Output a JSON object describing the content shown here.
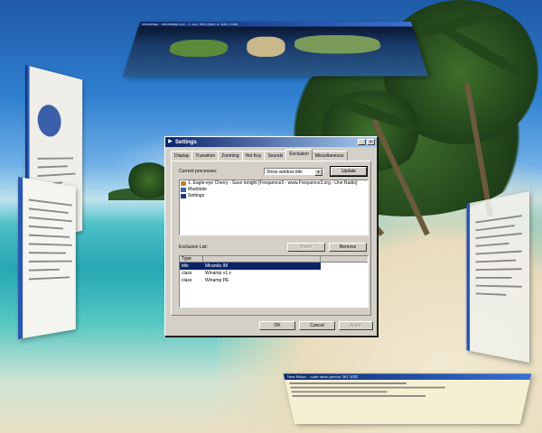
{
  "floating": {
    "top_title": "WorldMap - WorldMap.exe - 1 Gun Vien (Size 4, 100 x 100)",
    "bottom_title": "New Notes - carte wine presse 2k1 1002"
  },
  "dialog": {
    "title": "Settings",
    "tabs": [
      "Display",
      "Transition",
      "Zooming",
      "Hot Key",
      "Sounds",
      "Exclusion",
      "Miscellaneous"
    ],
    "active_tab": "Exclusion",
    "current_processes_label": "Current processes:",
    "filter_value": "Show window title",
    "update_label": "Update",
    "processes": [
      {
        "icon": "eagle-icon",
        "text": "1. Eagle-eye Cherry - Save tonight [Frequence3 - www.Frequence3.org - Une Radio]"
      },
      {
        "icon": "app-icon",
        "text": "Madotate"
      },
      {
        "icon": "settings-app-icon",
        "text": "Settings"
      }
    ],
    "exclusion_label": "Exclusion List:",
    "insert_label": "Insert",
    "remove_label": "Remove",
    "columns": [
      "Type",
      ""
    ],
    "exclusions": [
      {
        "type": "title",
        "name": "Miranda IM",
        "selected": true
      },
      {
        "type": "class",
        "name": "Winamp v1.x",
        "selected": false
      },
      {
        "type": "class",
        "name": "Winamp PE",
        "selected": false
      }
    ],
    "ok_label": "OK",
    "cancel_label": "Cancel",
    "apply_label": "Apply"
  }
}
